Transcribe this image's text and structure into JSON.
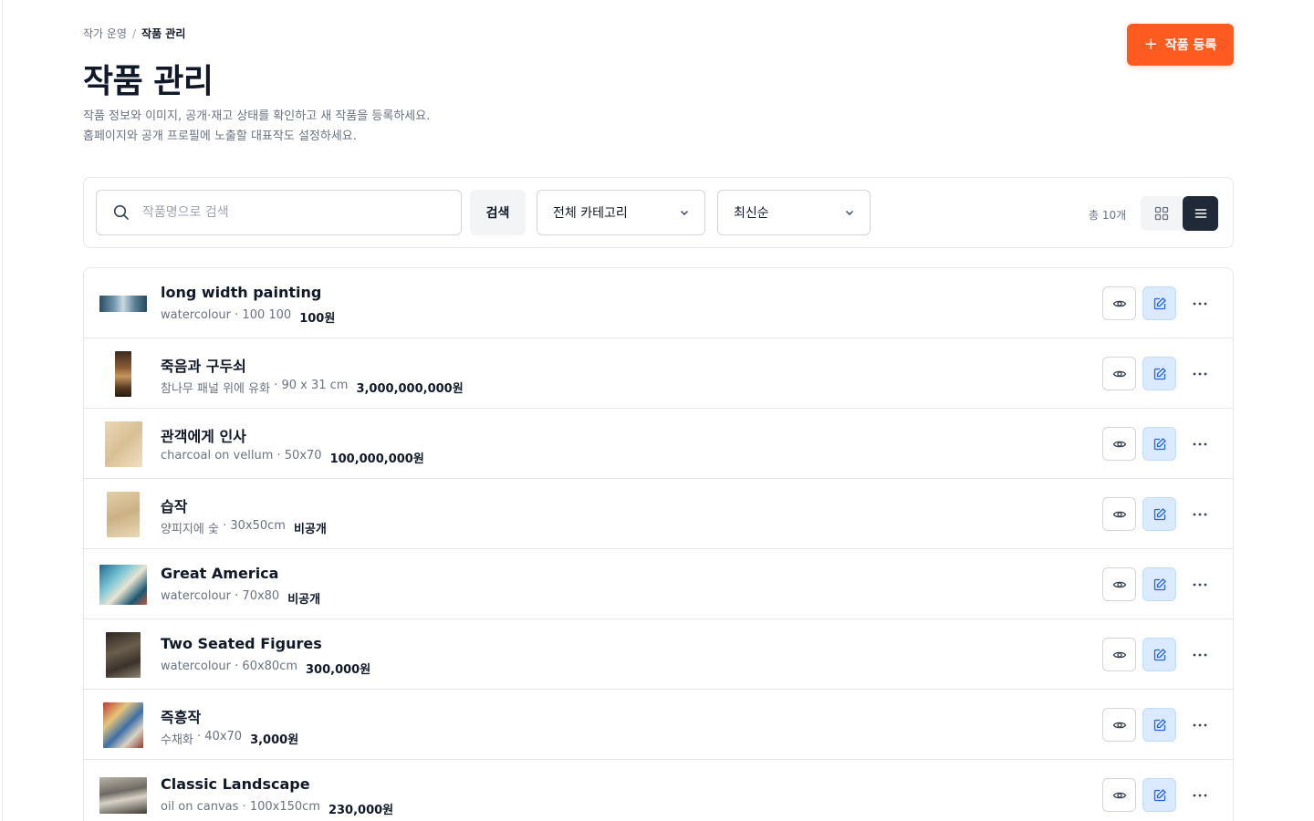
{
  "breadcrumb": {
    "parent": "작가 운영",
    "separator": "/",
    "current": "작품 관리"
  },
  "header": {
    "title": "작품 관리",
    "desc_line1": "작품 정보와 이미지, 공개·재고 상태를 확인하고 새 작품을 등록하세요.",
    "desc_line2": "홈페이지와 공개 프로필에 노출할 대표작도 설정하세요.",
    "add_button": "작품 등록"
  },
  "toolbar": {
    "search_placeholder": "작품명으로 검색",
    "search_button": "검색",
    "category_selected": "전체 카테고리",
    "sort_selected": "최신순",
    "total_text": "총 10개"
  },
  "colors": {
    "accent": "#ff5a1f",
    "edit_bg": "#dbeafe",
    "edit_icon": "#2563eb",
    "list_active": "#1f2937"
  },
  "artworks": [
    {
      "title": "long width painting",
      "medium": "watercolour",
      "size": "100 100",
      "price": "100원"
    },
    {
      "title": "죽음과 구두쇠",
      "medium": "참나무 패널 위에 유화",
      "size": "90 x 31 cm",
      "price": "3,000,000,000원"
    },
    {
      "title": "관객에게 인사",
      "medium": "charcoal on vellum",
      "size": "50x70",
      "price": "100,000,000원"
    },
    {
      "title": "습작",
      "medium": "양피지에 숯",
      "size": "30x50cm",
      "price": "비공개"
    },
    {
      "title": "Great America",
      "medium": "watercolour",
      "size": "70x80",
      "price": "비공개"
    },
    {
      "title": "Two Seated Figures",
      "medium": "watercolour",
      "size": "60x80cm",
      "price": "300,000원"
    },
    {
      "title": "즉흥작",
      "medium": "수채화",
      "size": "40x70",
      "price": "3,000원"
    },
    {
      "title": "Classic Landscape",
      "medium": "oil on canvas",
      "size": "100x150cm",
      "price": "230,000원"
    }
  ]
}
